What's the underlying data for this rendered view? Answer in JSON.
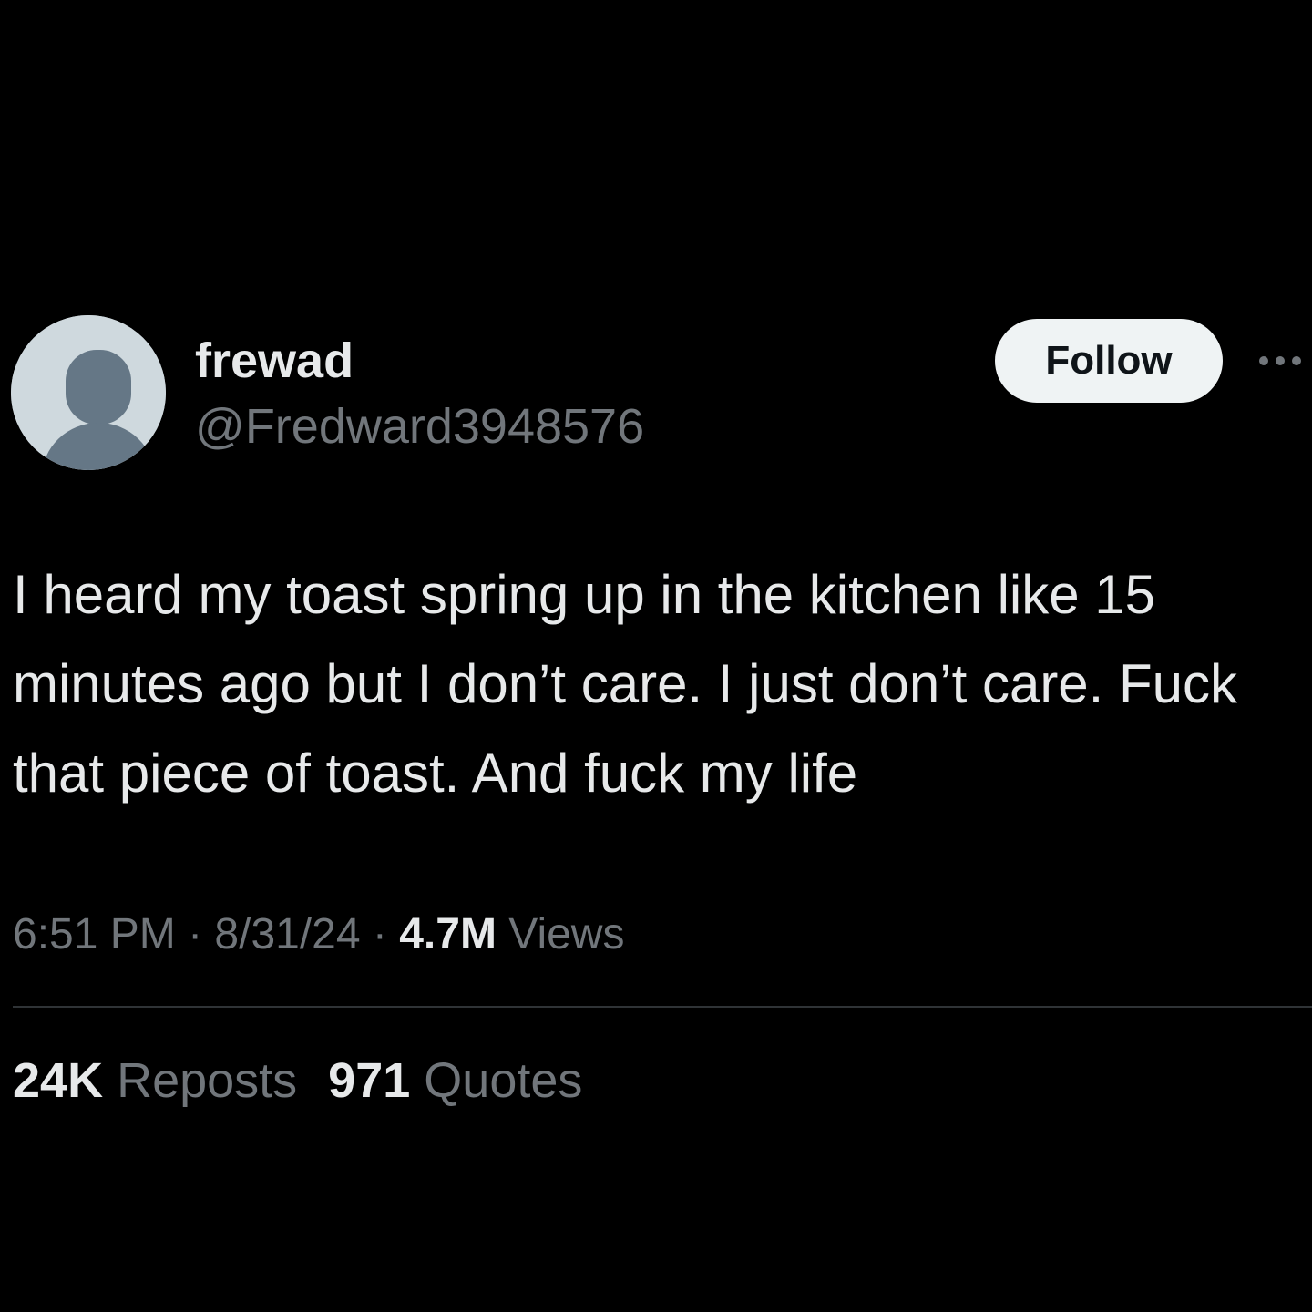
{
  "author": {
    "display_name": "frewad",
    "handle": "@Fredward3948576"
  },
  "actions": {
    "follow_label": "Follow",
    "more_icon": "more-horizontal-icon"
  },
  "post": {
    "text": "I heard my toast spring up in the kitchen like 15 minutes ago but I don’t care. I just don’t care. Fuck that piece of toast. And fuck my life"
  },
  "meta": {
    "time": "6:51 PM",
    "separator_1": " · ",
    "date": "8/31/24",
    "separator_2": " · ",
    "views_count": "4.7M",
    "views_label": " Views"
  },
  "stats": {
    "reposts_count": "24K",
    "reposts_label": " Reposts",
    "quotes_count": "971",
    "quotes_label": " Quotes"
  },
  "colors": {
    "background": "#000000",
    "primary_text": "#e7e9ea",
    "secondary_text": "#71767b",
    "follow_button_bg": "#eff3f4",
    "avatar_bg": "#cfd9de",
    "avatar_silhouette": "#657786",
    "divider": "#2f3336"
  }
}
